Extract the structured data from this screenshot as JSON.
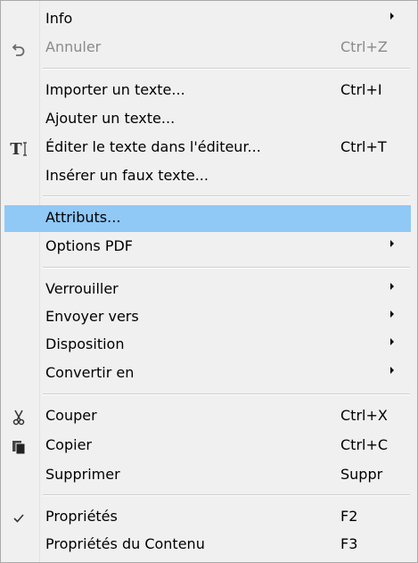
{
  "menu": {
    "info": {
      "label": "Info",
      "submenu": true
    },
    "undo": {
      "label": "Annuler",
      "shortcut": "Ctrl+Z",
      "icon": "undo-icon",
      "disabled": true
    },
    "import_text": {
      "label": "Importer un texte...",
      "shortcut": "Ctrl+I"
    },
    "append_text": {
      "label": "Ajouter un texte..."
    },
    "edit_text": {
      "label": "Éditer le texte dans l'éditeur...",
      "shortcut": "Ctrl+T",
      "icon": "text-edit-icon"
    },
    "lorem": {
      "label": "Insérer un faux texte..."
    },
    "attributes": {
      "label": "Attributs...",
      "highlighted": true
    },
    "pdf_options": {
      "label": "Options PDF",
      "submenu": true
    },
    "lock": {
      "label": "Verrouiller",
      "submenu": true
    },
    "send_to": {
      "label": "Envoyer vers",
      "submenu": true
    },
    "layout": {
      "label": "Disposition",
      "submenu": true
    },
    "convert": {
      "label": "Convertir en",
      "submenu": true
    },
    "cut": {
      "label": "Couper",
      "shortcut": "Ctrl+X",
      "icon": "scissors-icon"
    },
    "copy": {
      "label": "Copier",
      "shortcut": "Ctrl+C",
      "icon": "copy-icon"
    },
    "delete": {
      "label": "Supprimer",
      "shortcut": "Suppr"
    },
    "properties": {
      "label": "Propriétés",
      "shortcut": "F2",
      "checked": true,
      "icon": "checkmark-icon"
    },
    "content_properties": {
      "label": "Propriétés du Contenu",
      "shortcut": "F3"
    }
  },
  "colors": {
    "background": "#f0f0f0",
    "highlight": "#90c8f6",
    "disabled_text": "#8a8a8a"
  }
}
